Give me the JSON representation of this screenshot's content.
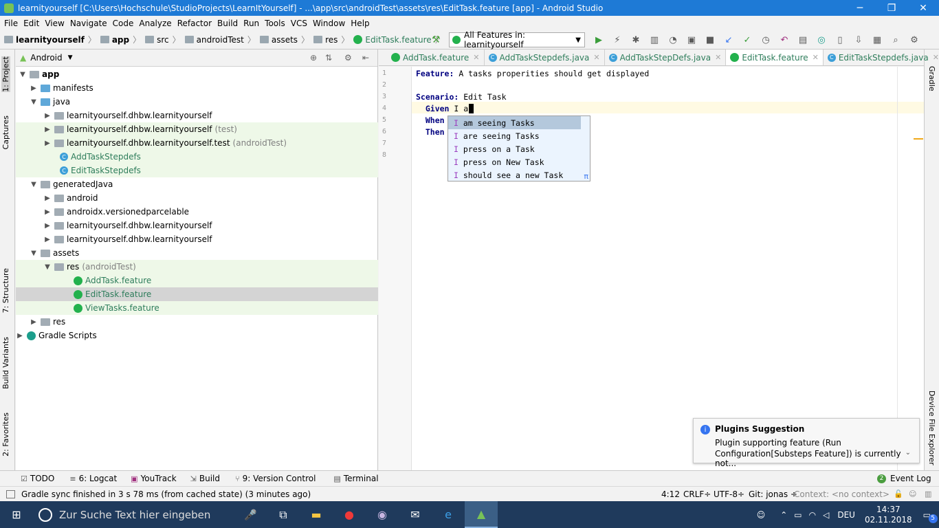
{
  "window": {
    "title": "learnityourself [C:\\Users\\Hochschule\\StudioProjects\\LearnItYourself] - ...\\app\\src\\androidTest\\assets\\res\\EditTask.feature [app] - Android Studio",
    "minimize": "─",
    "restore": "❐",
    "close": "✕"
  },
  "menu": [
    "File",
    "Edit",
    "View",
    "Navigate",
    "Code",
    "Analyze",
    "Refactor",
    "Build",
    "Run",
    "Tools",
    "VCS",
    "Window",
    "Help"
  ],
  "breadcrumb": [
    "learnityourself",
    "app",
    "src",
    "androidTest",
    "assets",
    "res",
    "EditTask.feature"
  ],
  "run_config": "All Features in: learnityourself",
  "left_strip": {
    "project": "1: Project",
    "captures": "Captures",
    "structure": "7: Structure",
    "build_variants": "Build Variants",
    "favorites": "2: Favorites"
  },
  "right_strip": {
    "gradle": "Gradle",
    "device_explorer": "Device File Explorer"
  },
  "project_panel": {
    "view": "Android"
  },
  "tree": [
    {
      "label": "app",
      "suffix": ""
    },
    {
      "label": "manifests",
      "suffix": ""
    },
    {
      "label": "java",
      "suffix": ""
    },
    {
      "label": "learnityourself.dhbw.learnityourself",
      "suffix": ""
    },
    {
      "label": "learnityourself.dhbw.learnityourself",
      "suffix": "(test)"
    },
    {
      "label": "learnityourself.dhbw.learnityourself.test",
      "suffix": "(androidTest)"
    },
    {
      "label": "AddTaskStepdefs",
      "suffix": ""
    },
    {
      "label": "EditTaskStepdefs",
      "suffix": ""
    },
    {
      "label": "generatedJava",
      "suffix": ""
    },
    {
      "label": "android",
      "suffix": ""
    },
    {
      "label": "androidx.versionedparcelable",
      "suffix": ""
    },
    {
      "label": "learnityourself.dhbw.learnityourself",
      "suffix": ""
    },
    {
      "label": "learnityourself.dhbw.learnityourself",
      "suffix": ""
    },
    {
      "label": "assets",
      "suffix": ""
    },
    {
      "label": "res",
      "suffix": "(androidTest)"
    },
    {
      "label": "AddTask.feature",
      "suffix": ""
    },
    {
      "label": "EditTask.feature",
      "suffix": ""
    },
    {
      "label": "ViewTasks.feature",
      "suffix": ""
    },
    {
      "label": "res",
      "suffix": ""
    },
    {
      "label": "Gradle Scripts",
      "suffix": ""
    }
  ],
  "tabs": [
    "AddTask.feature",
    "AddTaskStepdefs.java",
    "AddTaskStepDefs.java",
    "EditTask.feature",
    "EditTaskStepdefs.java"
  ],
  "tab_more": "≡5",
  "editor": {
    "line_numbers": [
      "1",
      "2",
      "3",
      "4",
      "5",
      "6",
      "7",
      "8"
    ],
    "l1_kw": "Feature:",
    "l1_text": " A tasks properities should get displayed",
    "l3_kw": "Scenario:",
    "l3_text": " Edit Task",
    "l4_kw": "  Given",
    "l4_text": " I a",
    "l5_kw": "  When",
    "l6_kw": "  Then"
  },
  "completion": [
    {
      "i": "I",
      "rest": " am seeing Tasks"
    },
    {
      "i": "I",
      "rest": " are seeing Tasks"
    },
    {
      "i": "I",
      "rest": " press on a Task"
    },
    {
      "i": "I",
      "rest": " press on New Task"
    },
    {
      "i": "I",
      "rest": " should see a new Task"
    }
  ],
  "completion_pi": "π",
  "notification": {
    "title": "Plugins Suggestion",
    "line1": "Plugin supporting feature (Run",
    "line2": "Configuration[Substeps Feature]) is currently not..."
  },
  "bottom_tabs": [
    "TODO",
    "6: Logcat",
    "YouTrack",
    "Build",
    "9: Version Control",
    "Terminal"
  ],
  "event_log": "Event Log",
  "event_count": "2",
  "status": {
    "message": "Gradle sync finished in 3 s 78 ms (from cached state) (3 minutes ago)",
    "pos": "4:12",
    "crlf": "CRLF÷",
    "enc": "UTF-8÷",
    "git": "Git: jonas ÷",
    "context": "Context: <no context>"
  },
  "taskbar": {
    "search": "Zur Suche Text hier eingeben",
    "lang": "DEU",
    "time": "14:37",
    "date": "02.11.2018",
    "notif": "5"
  }
}
